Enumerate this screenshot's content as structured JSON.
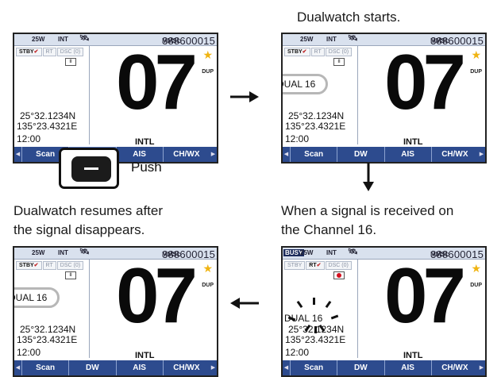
{
  "captions": {
    "top_right": "Dualwatch starts.",
    "bottom_left": [
      "Dualwatch resumes after",
      "the signal disappears."
    ],
    "bottom_right": [
      "When a signal is received on",
      "the Channel 16."
    ],
    "push": "Push"
  },
  "screen": {
    "power": "25W",
    "band": "INT",
    "busy": "BUSY",
    "mmsi_prefix": "MMSI:",
    "mmsi": "388600015",
    "tabs": {
      "stby": "STBY",
      "rt": "RT",
      "dsc": "DSC (0)"
    },
    "pause_icon": "II",
    "lat": "25°32.1234N",
    "lon": "135°23.4321E",
    "time": "12:00",
    "channel": "07",
    "dup": "DUP",
    "channel_group": "INTL",
    "dualwatch_label": "DUAL 16",
    "softkeys": [
      "Scan",
      "DW",
      "AIS",
      "CH/WX"
    ]
  },
  "icons": [
    "satellite-icon",
    "favorite-star-icon",
    "record-icon",
    "checkmark-icon",
    "left-arrow-icon",
    "right-arrow-icon",
    "down-arrow-icon",
    "dw-button-icon"
  ],
  "colors": {
    "softkey_bar": "#2d4b8e",
    "selected_key": "#5a7bc2",
    "star": "#f0b412",
    "record": "#d4101f"
  }
}
